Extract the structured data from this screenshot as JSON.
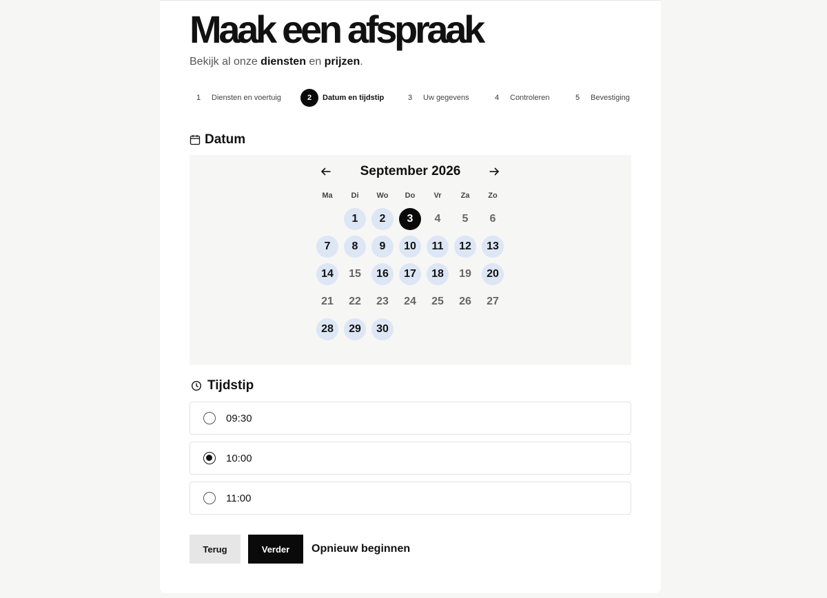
{
  "page": {
    "title": "Maak een afspraak",
    "subtitle": {
      "prefix": "Bekijk al onze ",
      "link_services": "diensten",
      "middle": " en ",
      "link_prices": "prijzen",
      "suffix": "."
    }
  },
  "steps": [
    {
      "number": "1",
      "label": "Diensten en voertuig",
      "active": false
    },
    {
      "number": "2",
      "label": "Datum en tijdstip",
      "active": true
    },
    {
      "number": "3",
      "label": "Uw gegevens",
      "active": false
    },
    {
      "number": "4",
      "label": "Controleren",
      "active": false
    },
    {
      "number": "5",
      "label": "Bevestiging",
      "active": false
    }
  ],
  "date_section": {
    "heading": "Datum",
    "icon": "calendar-icon",
    "prev_icon": "arrow-left-icon",
    "next_icon": "arrow-right-icon",
    "month_label": "September 2026",
    "weekdays": [
      "Ma",
      "Di",
      "Wo",
      "Do",
      "Vr",
      "Za",
      "Zo"
    ],
    "first_weekday_index": 1,
    "days": [
      {
        "day": "1",
        "state": "available"
      },
      {
        "day": "2",
        "state": "available"
      },
      {
        "day": "3",
        "state": "selected"
      },
      {
        "day": "4",
        "state": "unavailable"
      },
      {
        "day": "5",
        "state": "unavailable"
      },
      {
        "day": "6",
        "state": "unavailable"
      },
      {
        "day": "7",
        "state": "available"
      },
      {
        "day": "8",
        "state": "available"
      },
      {
        "day": "9",
        "state": "available"
      },
      {
        "day": "10",
        "state": "available"
      },
      {
        "day": "11",
        "state": "available"
      },
      {
        "day": "12",
        "state": "available"
      },
      {
        "day": "13",
        "state": "available"
      },
      {
        "day": "14",
        "state": "available"
      },
      {
        "day": "15",
        "state": "unavailable"
      },
      {
        "day": "16",
        "state": "available"
      },
      {
        "day": "17",
        "state": "available"
      },
      {
        "day": "18",
        "state": "available"
      },
      {
        "day": "19",
        "state": "unavailable"
      },
      {
        "day": "20",
        "state": "available"
      },
      {
        "day": "21",
        "state": "unavailable"
      },
      {
        "day": "22",
        "state": "unavailable"
      },
      {
        "day": "23",
        "state": "unavailable"
      },
      {
        "day": "24",
        "state": "unavailable"
      },
      {
        "day": "25",
        "state": "unavailable"
      },
      {
        "day": "26",
        "state": "unavailable"
      },
      {
        "day": "27",
        "state": "unavailable"
      },
      {
        "day": "28",
        "state": "available"
      },
      {
        "day": "29",
        "state": "available"
      },
      {
        "day": "30",
        "state": "available"
      }
    ]
  },
  "time_section": {
    "heading": "Tijdstip",
    "icon": "clock-icon",
    "options": [
      {
        "label": "09:30",
        "selected": false
      },
      {
        "label": "10:00",
        "selected": true
      },
      {
        "label": "11:00",
        "selected": false
      }
    ]
  },
  "actions": {
    "back_label": "Terug",
    "next_label": "Verder",
    "restart_label": "Opnieuw beginnen"
  },
  "colors": {
    "page_background": "#f6f6f5",
    "card_background": "#ffffff",
    "accent_dark": "#0a0a0a",
    "available_day": "#dde6f4",
    "secondary_button": "#e6e6e6"
  }
}
